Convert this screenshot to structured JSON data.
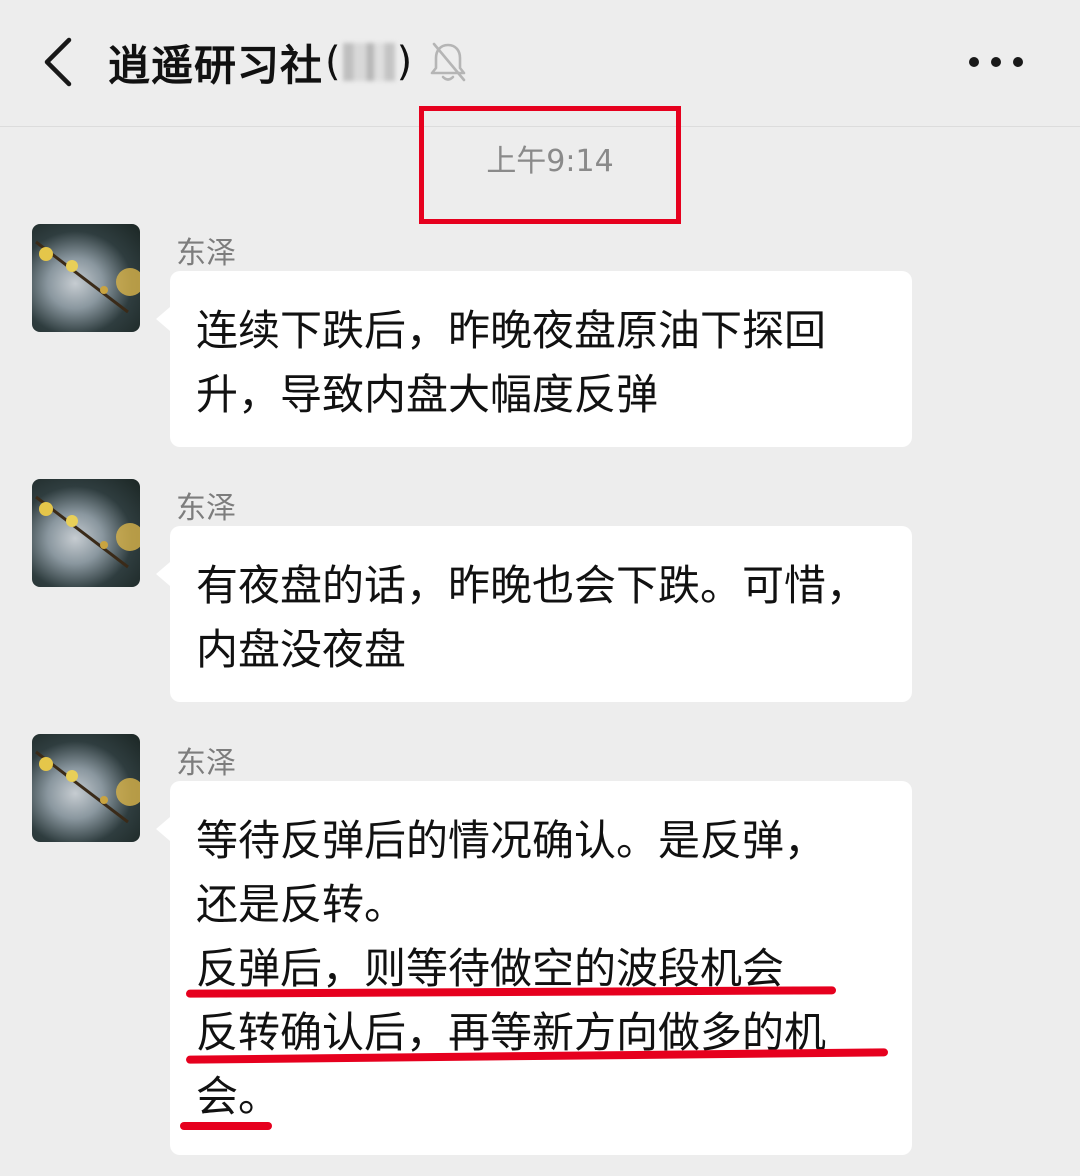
{
  "header": {
    "title": "逍遥研习社",
    "member_count_open": "(",
    "member_count_close": ")",
    "back_icon": "chevron-left-icon",
    "mute_icon": "bell-muted-icon",
    "more_icon": "more-horizontal-icon"
  },
  "timestamp": "上午9:14",
  "colors": {
    "background": "#ededed",
    "bubble": "#ffffff",
    "annotation_red": "#e6001e",
    "sender_gray": "#7d7d7d",
    "timestamp_gray": "#8a8a8a"
  },
  "messages": [
    {
      "sender": "东泽",
      "lines": [
        "连续下跌后，昨晚夜盘原油下探回",
        "升，导致内盘大幅度反弹"
      ]
    },
    {
      "sender": "东泽",
      "lines": [
        "有夜盘的话，昨晚也会下跌。可惜，",
        "内盘没夜盘"
      ]
    },
    {
      "sender": "东泽",
      "lines": [
        "等待反弹后的情况确认。是反弹，",
        "还是反转。",
        "反弹后，则等待做空的波段机会",
        "反转确认后，再等新方向做多的机",
        "会。"
      ]
    }
  ]
}
